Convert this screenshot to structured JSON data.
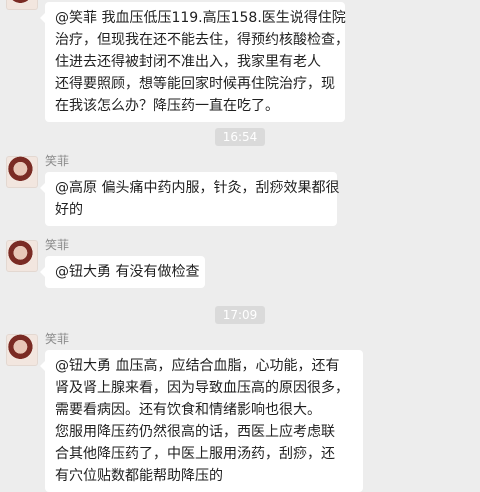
{
  "messages": [
    {
      "lines": [
        "@笑菲 我血压低压119.高压158.医生说得住院",
        "治疗，但现我在还不能去住，得预约核酸检查，",
        "住进去还得被封闭不准出入，我家里有老人",
        "还得要照顾，想等能回家时候再住院治疗，现",
        "在我该怎么办？降压药一直在吃了。"
      ]
    },
    {
      "time": "16:54"
    },
    {
      "sender": "笑菲",
      "lines": [
        "@高原 偏头痛中药内服，针灸，刮痧效果都很",
        "好的"
      ]
    },
    {
      "sender": "笑菲",
      "lines": [
        "@钮大勇 有没有做检查"
      ]
    },
    {
      "time": "17:09"
    },
    {
      "sender": "笑菲",
      "lines": [
        "@钮大勇 血压高，应结合血脂，心功能，还有",
        "肾及肾上腺来看，因为导致血压高的原因很多，",
        "需要看病因。还有饮食和情绪影响也很大。",
        "您服用降压药仍然很高的话，西医上应考虑联",
        "合其他降压药了，中医上服用汤药，刮痧，还",
        "有穴位贴数都能帮助降压的"
      ]
    }
  ]
}
